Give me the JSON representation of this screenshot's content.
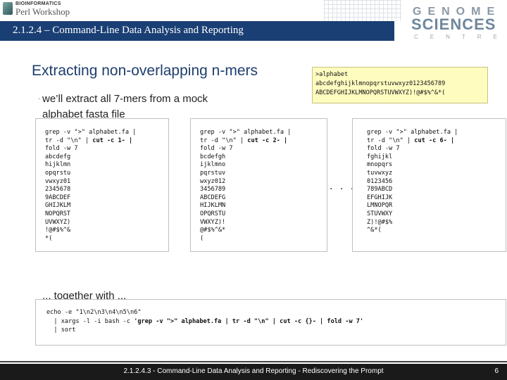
{
  "header": {
    "logo_small": "BIOINFORMATICS",
    "logo_big": "Perl Workshop",
    "title": "2.1.2.4 – Command-Line Data Analysis and Reporting",
    "gsc": {
      "line1": "GENOME",
      "line2": "SCIENCES",
      "line3": "CENTRE"
    }
  },
  "slide": {
    "title": "Extracting non-overlapping n-mers",
    "bullet1": "we’ll extract all 7-mers from a mock alphabet fasta file",
    "bullet2": "... together with ...",
    "alphabet_file": [
      ">alphabet",
      "abcdefghijklmnopqrstuvwxyz0123456789",
      "ABCDEFGHIJKLMNOPQRSTUVWXYZ)!@#$%^&*("
    ],
    "ellipsis": ". . .",
    "code_blocks": [
      {
        "cmd1": "grep -v \">\" alphabet.fa |",
        "cmd2_plain": "tr -d \"\\n\" | ",
        "cmd2_bold": "cut -c 1- |",
        "cmd3": "fold -w 7",
        "output": [
          "abcdefg",
          "hijklmn",
          "opqrstu",
          "vwxyz01",
          "2345678",
          "9ABCDEF",
          "GHIJKLM",
          "NOPQRST",
          "UVWXYZ)",
          "!@#$%^&",
          "*("
        ]
      },
      {
        "cmd1": "grep -v \">\" alphabet.fa |",
        "cmd2_plain": "tr -d \"\\n\" | ",
        "cmd2_bold": "cut -c 2- |",
        "cmd3": "fold -w 7",
        "output": [
          "bcdefgh",
          "ijklmno",
          "pqrstuv",
          "wxyz012",
          "3456789",
          "ABCDEFG",
          "HIJKLMN",
          "OPQRSTU",
          "VWXYZ)!",
          "@#$%^&*",
          "("
        ]
      },
      {
        "cmd1": "grep -v \">\" alphabet.fa |",
        "cmd2_plain": "tr -d \"\\n\" | ",
        "cmd2_bold": "cut -c 6- |",
        "cmd3": "fold -w 7",
        "output": [
          "fghijkl",
          "mnopqrs",
          "tuvwxyz",
          "0123456",
          "789ABCD",
          "EFGHIJK",
          "LMNOPQR",
          "STUVWXY",
          "Z)!@#$%",
          "^&*("
        ]
      }
    ],
    "command": {
      "line1": "echo -e \"1\\n2\\n3\\n4\\n5\\n6\"",
      "line2_plain": "  | xargs -l -i bash -c ",
      "line2_bold": "'grep -v \">\" alphabet.fa | tr -d \"\\n\" | cut -c {}- | fold -w 7'",
      "line3": "  | sort"
    }
  },
  "footer": {
    "text": "2.1.2.4.3 - Command-Line Data Analysis and Reporting - Rediscovering the Prompt",
    "page": "6"
  }
}
